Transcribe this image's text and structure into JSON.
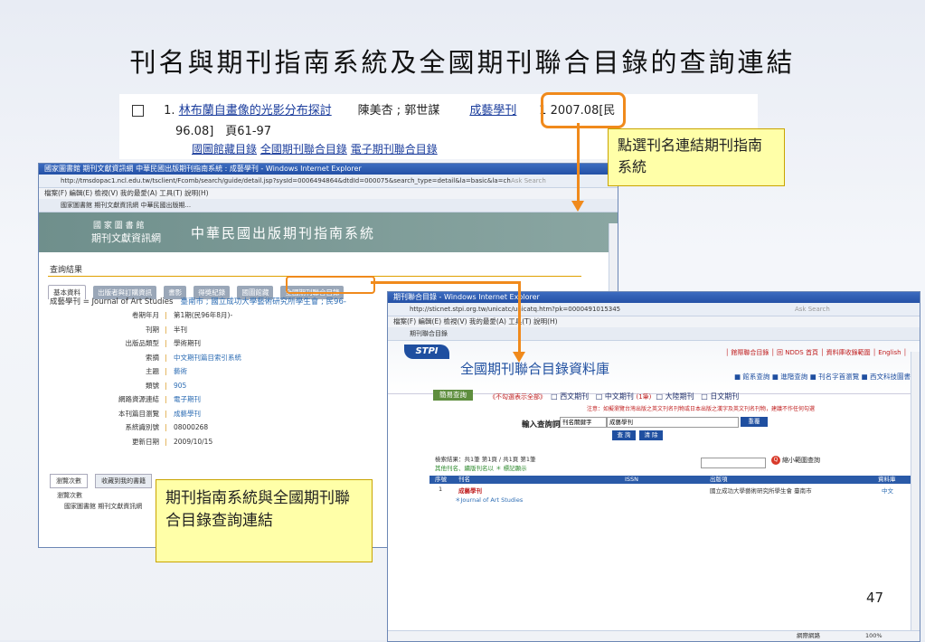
{
  "slide": {
    "title": "刊名與期刊指南系統及全國期刊聯合目錄的查詢連結",
    "page_number": "47"
  },
  "snippet": {
    "index": "1.",
    "article_title": "林布蘭自畫像的光影分布探討",
    "authors": "陳美杏 ; 郭世謀",
    "journal": "成藝學刊",
    "issue_a": "1 2007.08[民",
    "issue_b": "96.08]　頁61-97",
    "link1": "國圖館藏目錄",
    "link2": "全國期刊聯合目錄",
    "link3": "電子期刊聯合目錄"
  },
  "callouts": {
    "top_right": "點選刊名連結期刊指南系統",
    "bottom_left": "期刊指南系統與全國期刊聯合目錄查詢連結"
  },
  "window1": {
    "title": "國家圖書館 期刊文獻資訊網 中華民國出版期刊指南系統 : 成藝學刊 - Windows Internet Explorer",
    "address": "http://tmsdopac1.ncl.edu.tw/tsclient/Fcomb/search/guide/detail.jsp?sysId=0006494864&dtdId=000075&search_type=detail&la=basic&la=ch",
    "search_placeholder": "Ask Search",
    "menu": "檔案(F)   編輯(E)   檢視(V)   我的最愛(A)   工具(T)   說明(H)",
    "tab": "國家圖書館 期刊文獻資訊網 中華民國出版期...",
    "banner_line1": "國 家 圖 書 館",
    "banner_line2": "期刊文獻資訊網",
    "banner_system": "中華民國出版期刊指南系統",
    "result_heading": "查詢結果",
    "tabs": [
      "基本資料",
      "出版者與訂購資訊",
      "書影",
      "得獎紀錄",
      "國圖館藏",
      "全國期刊聯合目錄"
    ],
    "journal_line": "成藝學刊 = Journal of Art Studies",
    "journal_location": "臺南市 ; 國立成功大學藝術研究所學生會 ; 民96-",
    "info": [
      {
        "label": "卷期年月",
        "value": "第1期(民96年8月)-"
      },
      {
        "label": "刊期",
        "value": "半刊"
      },
      {
        "label": "出版品類型",
        "value": "學術期刊"
      },
      {
        "label": "索摘",
        "value": "中文期刊篇目索引系統"
      },
      {
        "label": "主題",
        "value": "藝術"
      },
      {
        "label": "類號",
        "value": "905"
      },
      {
        "label": "網路資源連結",
        "value": "電子期刊"
      },
      {
        "label": "本刊篇目瀏覽",
        "value": "成藝學刊"
      },
      {
        "label": "系統識別號",
        "value": "08000268"
      },
      {
        "label": "更新日期",
        "value": "2009/10/15"
      }
    ],
    "bottom_tabs": [
      "瀏覽次數",
      "收藏到我的書籍"
    ],
    "browse_title": "瀏覽次數",
    "browse_item": "國家圖書館 期刊文獻資訊網"
  },
  "window2": {
    "title": "期刊聯合目錄 - Windows Internet Explorer",
    "address": "http://sticnet.stpi.org.tw/unicatc/unicatq.htm?pk=0000491015345",
    "search_placeholder": "Ask Search",
    "menu": "檔案(F)   編輯(E)   檢視(V)   我的最愛(A)   工具(T)   說明(H)",
    "tab": "期刊聯合目錄",
    "logo": "STPI",
    "site_title": "全國期刊聯合目錄資料庫",
    "top_links": "│ 館際聯合目錄 │ 回 NDDS 首頁 │ 資料庫收錄範圍 │ English │",
    "nav_links": "■ 館系查詢 ■ 進階查詢 ■ 刊名字首瀏覽 ■ 西文科技圖書",
    "simple_search": "簡易查詢",
    "all_db": "《不勾選表示全部》",
    "filters": [
      "西文期刊",
      "中文期刊",
      "大陸期刊",
      "日文期刊"
    ],
    "cjk_count": "(1筆)",
    "notice": "注意：如擬瀏覽台灣出版之英文刊名刊物或日本出版之漢字及英文刊名刊物，建議不作任何勾選",
    "query_label": "輸入查詢詞",
    "query_field": "刊名關鍵字",
    "query_value": "成藝學刊",
    "btn_clear": "重覆",
    "btn_query": "查 詢",
    "btn_cancel": "清 除",
    "result_summary": "檢索結果：共1筆 第1頁 / 共1頁 第1筆",
    "result_sub": "其他刊名、續版刊名以 ＊ 標記顯示",
    "narrow_label": "縮小範圍查詢",
    "headers": [
      "序號",
      "刊名",
      "ISSN",
      "出版項",
      "資料庫"
    ],
    "row": {
      "no": "1",
      "title": "成藝學刊",
      "publisher": "國立成功大學藝術研究所學生會 臺南市",
      "db": "中文"
    },
    "row_sub": "＊Journal of Art Studies",
    "status_zone": "網際網路",
    "zoom": "100%"
  }
}
